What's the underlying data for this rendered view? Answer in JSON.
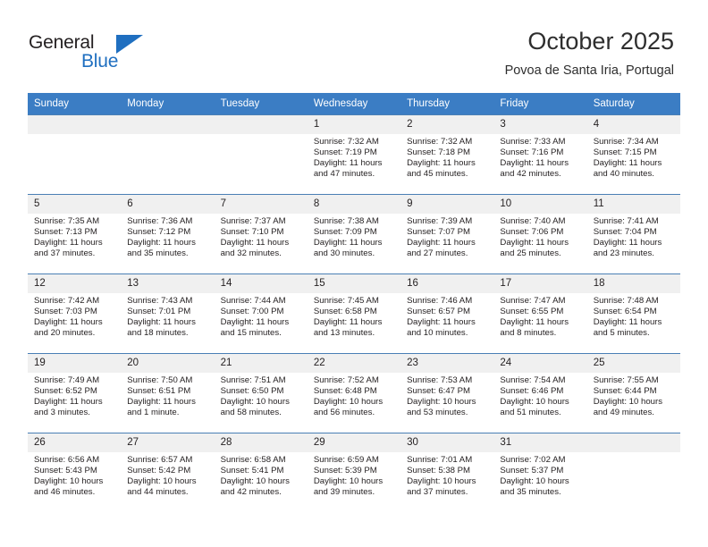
{
  "brand": {
    "name_part1": "General",
    "name_part2": "Blue",
    "accent_color": "#1f6fc0"
  },
  "header": {
    "title": "October 2025",
    "subtitle": "Povoa de Santa Iria, Portugal"
  },
  "theme": {
    "header_row_bg": "#3b7dc4",
    "daynum_bg": "#f0f0f0",
    "grid_line": "#4a7fb5"
  },
  "weekdays": [
    "Sunday",
    "Monday",
    "Tuesday",
    "Wednesday",
    "Thursday",
    "Friday",
    "Saturday"
  ],
  "weeks": [
    [
      {
        "day": "",
        "blank": true,
        "sunrise": "",
        "sunset": "",
        "daylight1": "",
        "daylight2": ""
      },
      {
        "day": "",
        "blank": true,
        "sunrise": "",
        "sunset": "",
        "daylight1": "",
        "daylight2": ""
      },
      {
        "day": "",
        "blank": true,
        "sunrise": "",
        "sunset": "",
        "daylight1": "",
        "daylight2": ""
      },
      {
        "day": "1",
        "sunrise": "Sunrise: 7:32 AM",
        "sunset": "Sunset: 7:19 PM",
        "daylight1": "Daylight: 11 hours",
        "daylight2": "and 47 minutes."
      },
      {
        "day": "2",
        "sunrise": "Sunrise: 7:32 AM",
        "sunset": "Sunset: 7:18 PM",
        "daylight1": "Daylight: 11 hours",
        "daylight2": "and 45 minutes."
      },
      {
        "day": "3",
        "sunrise": "Sunrise: 7:33 AM",
        "sunset": "Sunset: 7:16 PM",
        "daylight1": "Daylight: 11 hours",
        "daylight2": "and 42 minutes."
      },
      {
        "day": "4",
        "sunrise": "Sunrise: 7:34 AM",
        "sunset": "Sunset: 7:15 PM",
        "daylight1": "Daylight: 11 hours",
        "daylight2": "and 40 minutes."
      }
    ],
    [
      {
        "day": "5",
        "sunrise": "Sunrise: 7:35 AM",
        "sunset": "Sunset: 7:13 PM",
        "daylight1": "Daylight: 11 hours",
        "daylight2": "and 37 minutes."
      },
      {
        "day": "6",
        "sunrise": "Sunrise: 7:36 AM",
        "sunset": "Sunset: 7:12 PM",
        "daylight1": "Daylight: 11 hours",
        "daylight2": "and 35 minutes."
      },
      {
        "day": "7",
        "sunrise": "Sunrise: 7:37 AM",
        "sunset": "Sunset: 7:10 PM",
        "daylight1": "Daylight: 11 hours",
        "daylight2": "and 32 minutes."
      },
      {
        "day": "8",
        "sunrise": "Sunrise: 7:38 AM",
        "sunset": "Sunset: 7:09 PM",
        "daylight1": "Daylight: 11 hours",
        "daylight2": "and 30 minutes."
      },
      {
        "day": "9",
        "sunrise": "Sunrise: 7:39 AM",
        "sunset": "Sunset: 7:07 PM",
        "daylight1": "Daylight: 11 hours",
        "daylight2": "and 27 minutes."
      },
      {
        "day": "10",
        "sunrise": "Sunrise: 7:40 AM",
        "sunset": "Sunset: 7:06 PM",
        "daylight1": "Daylight: 11 hours",
        "daylight2": "and 25 minutes."
      },
      {
        "day": "11",
        "sunrise": "Sunrise: 7:41 AM",
        "sunset": "Sunset: 7:04 PM",
        "daylight1": "Daylight: 11 hours",
        "daylight2": "and 23 minutes."
      }
    ],
    [
      {
        "day": "12",
        "sunrise": "Sunrise: 7:42 AM",
        "sunset": "Sunset: 7:03 PM",
        "daylight1": "Daylight: 11 hours",
        "daylight2": "and 20 minutes."
      },
      {
        "day": "13",
        "sunrise": "Sunrise: 7:43 AM",
        "sunset": "Sunset: 7:01 PM",
        "daylight1": "Daylight: 11 hours",
        "daylight2": "and 18 minutes."
      },
      {
        "day": "14",
        "sunrise": "Sunrise: 7:44 AM",
        "sunset": "Sunset: 7:00 PM",
        "daylight1": "Daylight: 11 hours",
        "daylight2": "and 15 minutes."
      },
      {
        "day": "15",
        "sunrise": "Sunrise: 7:45 AM",
        "sunset": "Sunset: 6:58 PM",
        "daylight1": "Daylight: 11 hours",
        "daylight2": "and 13 minutes."
      },
      {
        "day": "16",
        "sunrise": "Sunrise: 7:46 AM",
        "sunset": "Sunset: 6:57 PM",
        "daylight1": "Daylight: 11 hours",
        "daylight2": "and 10 minutes."
      },
      {
        "day": "17",
        "sunrise": "Sunrise: 7:47 AM",
        "sunset": "Sunset: 6:55 PM",
        "daylight1": "Daylight: 11 hours",
        "daylight2": "and 8 minutes."
      },
      {
        "day": "18",
        "sunrise": "Sunrise: 7:48 AM",
        "sunset": "Sunset: 6:54 PM",
        "daylight1": "Daylight: 11 hours",
        "daylight2": "and 5 minutes."
      }
    ],
    [
      {
        "day": "19",
        "sunrise": "Sunrise: 7:49 AM",
        "sunset": "Sunset: 6:52 PM",
        "daylight1": "Daylight: 11 hours",
        "daylight2": "and 3 minutes."
      },
      {
        "day": "20",
        "sunrise": "Sunrise: 7:50 AM",
        "sunset": "Sunset: 6:51 PM",
        "daylight1": "Daylight: 11 hours",
        "daylight2": "and 1 minute."
      },
      {
        "day": "21",
        "sunrise": "Sunrise: 7:51 AM",
        "sunset": "Sunset: 6:50 PM",
        "daylight1": "Daylight: 10 hours",
        "daylight2": "and 58 minutes."
      },
      {
        "day": "22",
        "sunrise": "Sunrise: 7:52 AM",
        "sunset": "Sunset: 6:48 PM",
        "daylight1": "Daylight: 10 hours",
        "daylight2": "and 56 minutes."
      },
      {
        "day": "23",
        "sunrise": "Sunrise: 7:53 AM",
        "sunset": "Sunset: 6:47 PM",
        "daylight1": "Daylight: 10 hours",
        "daylight2": "and 53 minutes."
      },
      {
        "day": "24",
        "sunrise": "Sunrise: 7:54 AM",
        "sunset": "Sunset: 6:46 PM",
        "daylight1": "Daylight: 10 hours",
        "daylight2": "and 51 minutes."
      },
      {
        "day": "25",
        "sunrise": "Sunrise: 7:55 AM",
        "sunset": "Sunset: 6:44 PM",
        "daylight1": "Daylight: 10 hours",
        "daylight2": "and 49 minutes."
      }
    ],
    [
      {
        "day": "26",
        "sunrise": "Sunrise: 6:56 AM",
        "sunset": "Sunset: 5:43 PM",
        "daylight1": "Daylight: 10 hours",
        "daylight2": "and 46 minutes."
      },
      {
        "day": "27",
        "sunrise": "Sunrise: 6:57 AM",
        "sunset": "Sunset: 5:42 PM",
        "daylight1": "Daylight: 10 hours",
        "daylight2": "and 44 minutes."
      },
      {
        "day": "28",
        "sunrise": "Sunrise: 6:58 AM",
        "sunset": "Sunset: 5:41 PM",
        "daylight1": "Daylight: 10 hours",
        "daylight2": "and 42 minutes."
      },
      {
        "day": "29",
        "sunrise": "Sunrise: 6:59 AM",
        "sunset": "Sunset: 5:39 PM",
        "daylight1": "Daylight: 10 hours",
        "daylight2": "and 39 minutes."
      },
      {
        "day": "30",
        "sunrise": "Sunrise: 7:01 AM",
        "sunset": "Sunset: 5:38 PM",
        "daylight1": "Daylight: 10 hours",
        "daylight2": "and 37 minutes."
      },
      {
        "day": "31",
        "sunrise": "Sunrise: 7:02 AM",
        "sunset": "Sunset: 5:37 PM",
        "daylight1": "Daylight: 10 hours",
        "daylight2": "and 35 minutes."
      },
      {
        "day": "",
        "blank": true,
        "sunrise": "",
        "sunset": "",
        "daylight1": "",
        "daylight2": ""
      }
    ]
  ]
}
